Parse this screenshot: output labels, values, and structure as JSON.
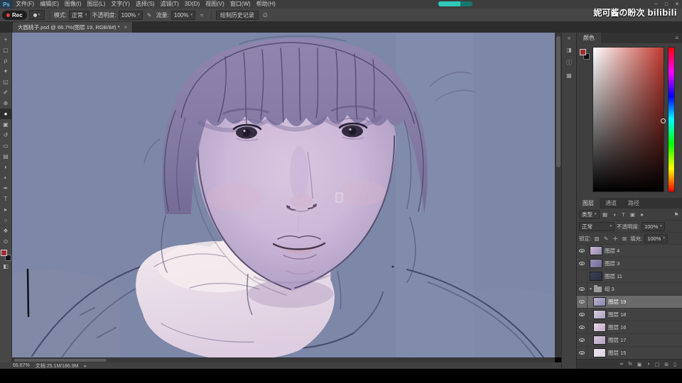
{
  "watermark": {
    "name": "妮可酱の盼次",
    "brand": "bilibili"
  },
  "menubar": {
    "app": "Ps",
    "items": [
      "文件(F)",
      "编辑(E)",
      "图像(I)",
      "图层(L)",
      "文字(Y)",
      "选择(S)",
      "滤镜(T)",
      "3D(D)",
      "视图(V)",
      "窗口(W)",
      "帮助(H)"
    ],
    "window_controls": {
      "minimize": "─",
      "maximize": "□",
      "close": "✕"
    }
  },
  "recorder": {
    "label": "Rec"
  },
  "options_bar": {
    "mode_label": "模式:",
    "mode_value": "正常",
    "opacity_label": "不透明度:",
    "opacity_value": "100%",
    "flow_label": "流量:",
    "flow_value": "100%",
    "history_button": "绘制历史记录",
    "pressure_icon": "✎",
    "airbrush_icon": "≈",
    "symmetry_icon": "∅"
  },
  "document_tab": {
    "title": "大圆桃子.psd @ 66.7%(图层 19, RGB/8#) *",
    "close": "×"
  },
  "toolbar": {
    "tools": [
      {
        "name": "move",
        "glyph": "+"
      },
      {
        "name": "marquee",
        "glyph": "▢"
      },
      {
        "name": "lasso",
        "glyph": "ρ"
      },
      {
        "name": "quick-select",
        "glyph": "✦"
      },
      {
        "name": "crop",
        "glyph": "◱"
      },
      {
        "name": "eyedropper",
        "glyph": "✐"
      },
      {
        "name": "healing-brush",
        "glyph": "⊕"
      },
      {
        "name": "brush",
        "glyph": "●"
      },
      {
        "name": "clone-stamp",
        "glyph": "▣"
      },
      {
        "name": "history-brush",
        "glyph": "↺"
      },
      {
        "name": "eraser",
        "glyph": "▭"
      },
      {
        "name": "gradient",
        "glyph": "▤"
      },
      {
        "name": "blur",
        "glyph": "◗"
      },
      {
        "name": "dodge",
        "glyph": "◐"
      },
      {
        "name": "pen",
        "glyph": "✒"
      },
      {
        "name": "type",
        "glyph": "T"
      },
      {
        "name": "path-select",
        "glyph": "▸"
      },
      {
        "name": "shape",
        "glyph": "○"
      },
      {
        "name": "hand",
        "glyph": "❖"
      },
      {
        "name": "zoom",
        "glyph": "⊙"
      }
    ],
    "quick_mask": "◧",
    "foreground_color": "#a22c2c",
    "background_color": "#14141a"
  },
  "right_rail": {
    "icons": [
      {
        "name": "collapse-panels",
        "glyph": "«"
      },
      {
        "name": "libraries",
        "glyph": "◨"
      },
      {
        "name": "info",
        "glyph": "ⓘ"
      },
      {
        "name": "properties",
        "glyph": "▦"
      }
    ]
  },
  "color_panel": {
    "tab": "颜色",
    "menu_icon": "≡",
    "foreground_color": "#a22c2c",
    "hue_color": "#c13a30"
  },
  "layers_panel": {
    "tabs": [
      "图层",
      "通道",
      "路径"
    ],
    "filter": {
      "label": "类型",
      "caret": "▾",
      "icons": [
        "▦",
        "◑",
        "T",
        "▣",
        "●"
      ],
      "flag": "⚑"
    },
    "blend": {
      "mode": "正常",
      "caret": "▾",
      "opacity_label": "不透明度:",
      "opacity": "100%"
    },
    "lock": {
      "label": "锁定:",
      "icons": [
        "▨",
        "✎",
        "✛",
        "⊠"
      ],
      "fill_label": "填充:",
      "fill": "100%"
    },
    "rows": [
      {
        "name": "图层 4",
        "visible": true
      },
      {
        "name": "图层 3",
        "visible": true
      },
      {
        "name": "图层 11",
        "visible": false
      },
      {
        "name": "组 3",
        "visible": true,
        "group": true,
        "caret": "▼"
      },
      {
        "name": "图层 19",
        "visible": true,
        "selected": true
      },
      {
        "name": "图层 18",
        "visible": true
      },
      {
        "name": "图层 16",
        "visible": true
      },
      {
        "name": "图层 17",
        "visible": true
      },
      {
        "name": "图层 15",
        "visible": true
      }
    ],
    "footer_icons": [
      "∞",
      "fx",
      "▣",
      "◑",
      "▢",
      "⊞",
      "▯"
    ]
  },
  "status_bar": {
    "zoom": "66.67%",
    "document": "文档:25.1M/186.9M",
    "arrow": "▸"
  },
  "ui": {
    "caret": "▾"
  }
}
